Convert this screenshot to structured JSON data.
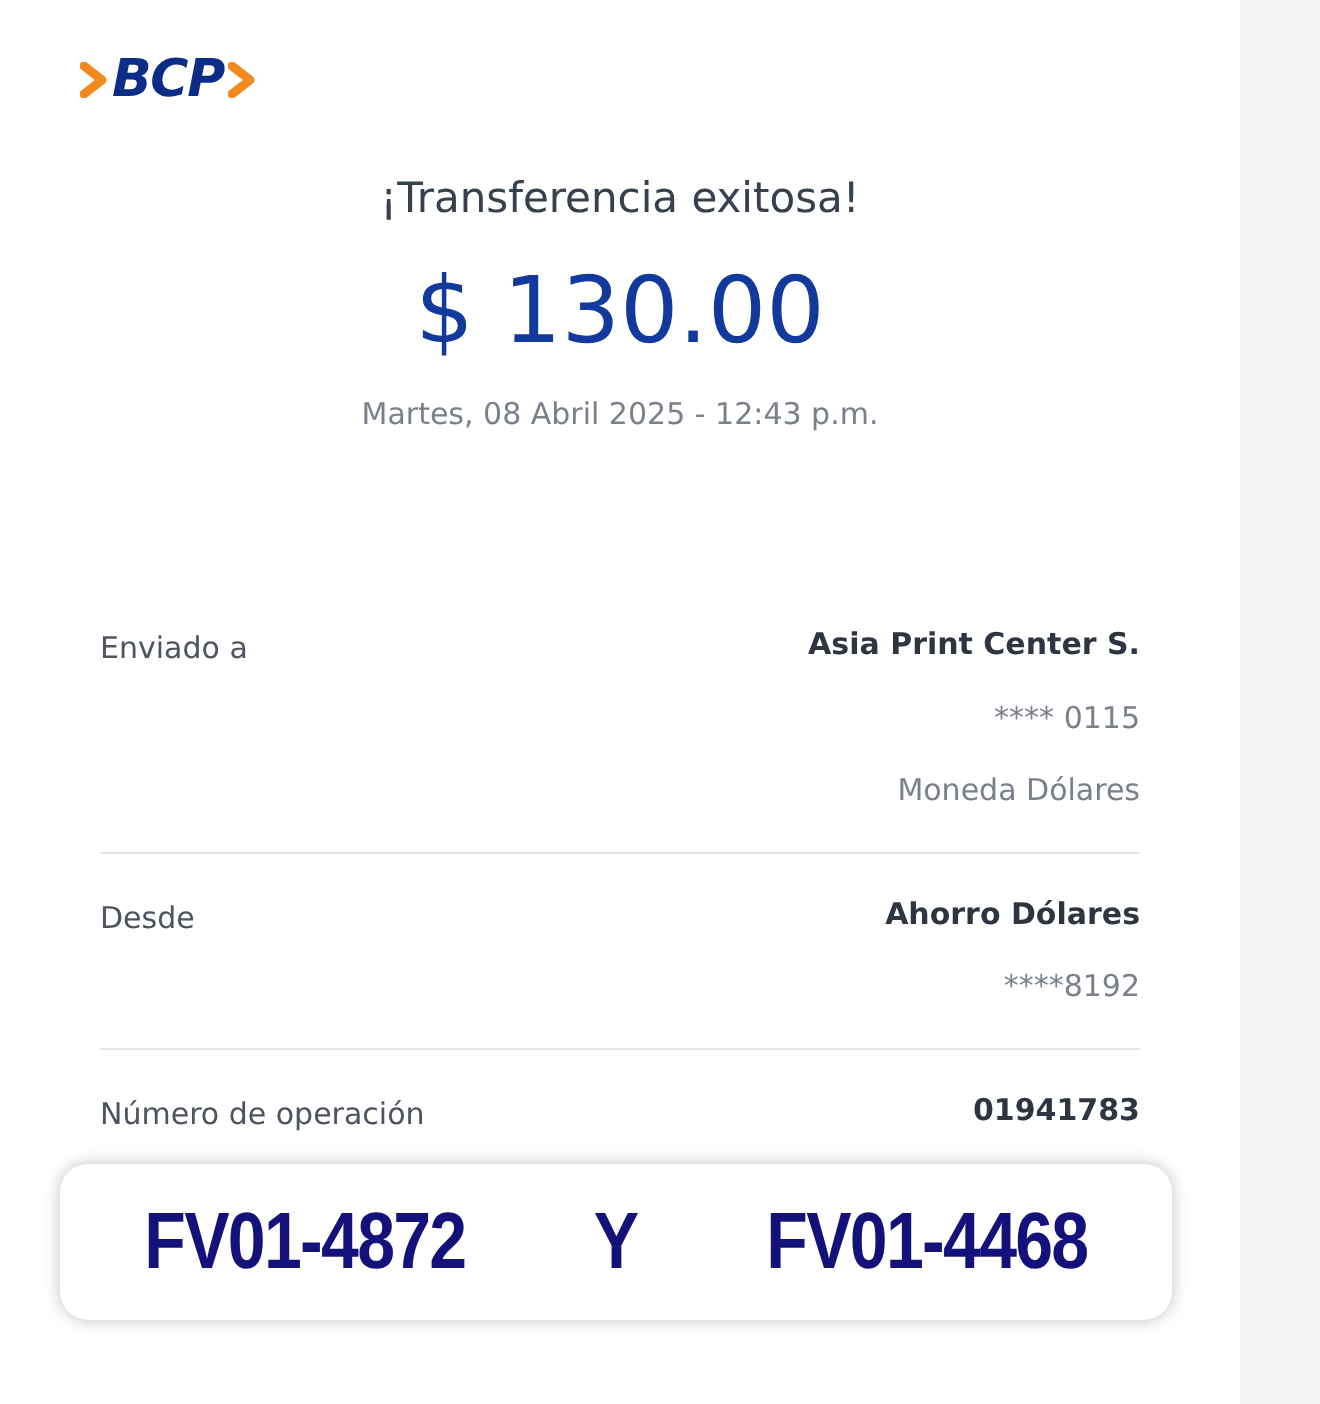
{
  "logo": {
    "text": "BCP"
  },
  "title": "¡Transferencia exitosa!",
  "amount": "$ 130.00",
  "datetime": "Martes, 08 Abril 2025 - 12:43 p.m.",
  "details": [
    {
      "label": "Enviado a",
      "values": [
        "Asia Print Center S.",
        "**** 0115",
        "Moneda Dólares"
      ]
    },
    {
      "label": "Desde",
      "values": [
        "Ahorro Dólares",
        "****8192"
      ]
    },
    {
      "label": "Número de operación",
      "values": [
        "01941783"
      ]
    }
  ],
  "note": [
    "FV01-4872",
    "Y",
    "FV01-4468"
  ]
}
